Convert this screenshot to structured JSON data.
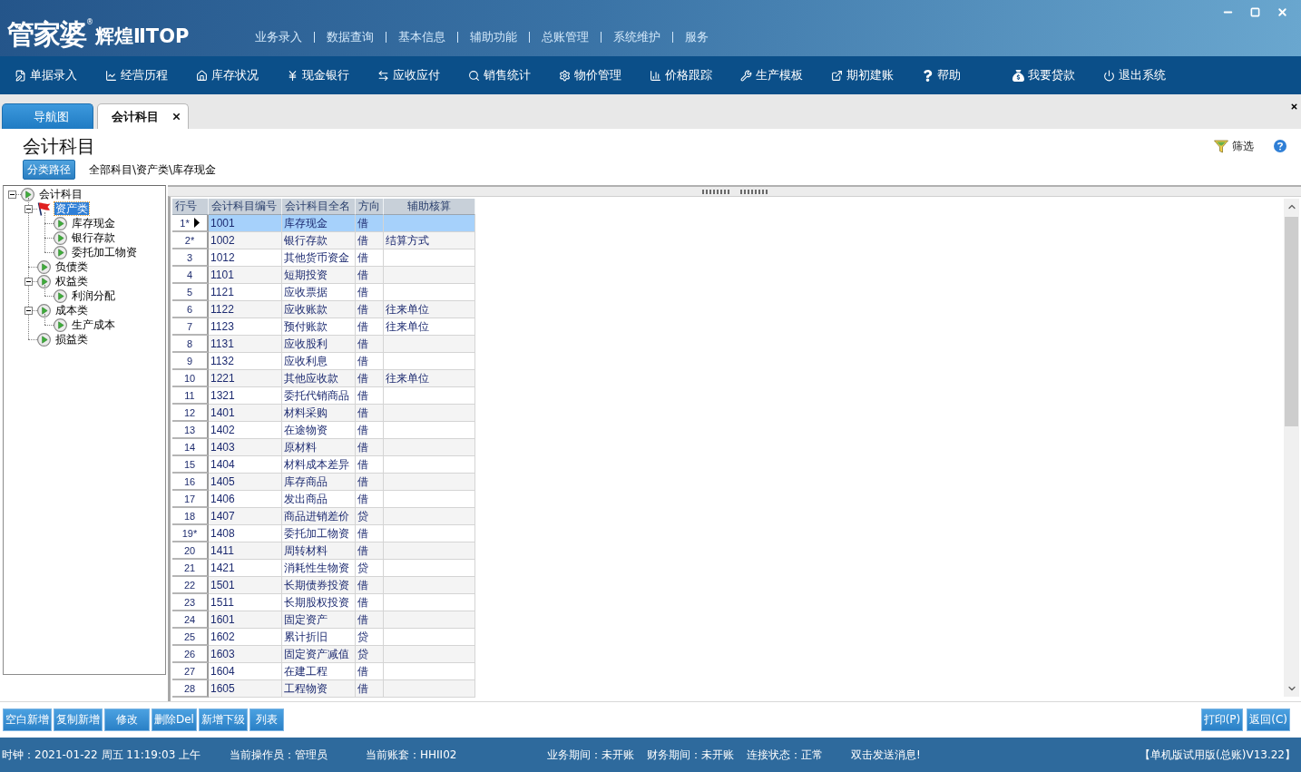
{
  "app_header": {
    "logo": {
      "main": "管家婆",
      "mark": "®",
      "sub": "辉煌ⅡTOP"
    },
    "menu": [
      "业务录入",
      "数据查询",
      "基本信息",
      "辅助功能",
      "总账管理",
      "系统维护",
      "服务"
    ]
  },
  "nav_toolbar": [
    "单据录入",
    "经营历程",
    "库存状况",
    "现金银行",
    "应收应付",
    "销售统计",
    "物价管理",
    "价格跟踪",
    "生产模板",
    "期初建账",
    "帮助",
    "我要贷款",
    "退出系统"
  ],
  "tabs": [
    {
      "label": "导航图",
      "selected": false,
      "closable": false
    },
    {
      "label": "会计科目",
      "selected": true,
      "closable": true
    }
  ],
  "page": {
    "title": "会计科目",
    "filter_label": "筛选",
    "path_button": "分类路径",
    "path": "全部科目\\资产类\\库存现金"
  },
  "tree": [
    {
      "label": "会计科目",
      "selected": false,
      "expanded": true,
      "children": [
        {
          "label": "资产类",
          "selected": true,
          "expanded": true,
          "children": [
            {
              "label": "库存现金",
              "selected": false
            },
            {
              "label": "银行存款",
              "selected": false
            },
            {
              "label": "委托加工物资",
              "selected": false
            }
          ]
        },
        {
          "label": "负债类",
          "selected": false
        },
        {
          "label": "权益类",
          "selected": false,
          "expanded": true,
          "children": [
            {
              "label": "利润分配",
              "selected": false
            }
          ]
        },
        {
          "label": "成本类",
          "selected": false,
          "expanded": true,
          "children": [
            {
              "label": "生产成本",
              "selected": false
            }
          ]
        },
        {
          "label": "损益类",
          "selected": false
        }
      ]
    }
  ],
  "table": {
    "columns": [
      "行号",
      "会计科目编号",
      "会计科目全名",
      "方向",
      "辅助核算"
    ],
    "rows": [
      {
        "no": "1*",
        "code": "1001",
        "name": "库存现金",
        "direction": "借",
        "selected": true
      },
      {
        "no": "2*",
        "code": "1002",
        "name": "银行存款",
        "direction": "借",
        "auxiliary": "结算方式",
        "selected": false
      },
      {
        "no": "3",
        "code": "1012",
        "name": "其他货币资金",
        "direction": "借",
        "selected": false
      },
      {
        "no": "4",
        "code": "1101",
        "name": "短期投资",
        "direction": "借",
        "selected": false
      },
      {
        "no": "5",
        "code": "1121",
        "name": "应收票据",
        "direction": "借",
        "selected": false
      },
      {
        "no": "6",
        "code": "1122",
        "name": "应收账款",
        "direction": "借",
        "auxiliary": "往来单位",
        "selected": false
      },
      {
        "no": "7",
        "code": "1123",
        "name": "预付账款",
        "direction": "借",
        "auxiliary": "往来单位",
        "selected": false
      },
      {
        "no": "8",
        "code": "1131",
        "name": "应收股利",
        "direction": "借",
        "selected": false
      },
      {
        "no": "9",
        "code": "1132",
        "name": "应收利息",
        "direction": "借",
        "selected": false
      },
      {
        "no": "10",
        "code": "1221",
        "name": "其他应收款",
        "direction": "借",
        "auxiliary": "往来单位",
        "selected": false
      },
      {
        "no": "11",
        "code": "1321",
        "name": "委托代销商品",
        "direction": "借",
        "selected": false
      },
      {
        "no": "12",
        "code": "1401",
        "name": "材料采购",
        "direction": "借",
        "selected": false
      },
      {
        "no": "13",
        "code": "1402",
        "name": "在途物资",
        "direction": "借",
        "selected": false
      },
      {
        "no": "14",
        "code": "1403",
        "name": "原材料",
        "direction": "借",
        "selected": false
      },
      {
        "no": "15",
        "code": "1404",
        "name": "材料成本差异",
        "direction": "借",
        "selected": false
      },
      {
        "no": "16",
        "code": "1405",
        "name": "库存商品",
        "direction": "借",
        "selected": false
      },
      {
        "no": "17",
        "code": "1406",
        "name": "发出商品",
        "direction": "借",
        "selected": false
      },
      {
        "no": "18",
        "code": "1407",
        "name": "商品进销差价",
        "direction": "贷",
        "selected": false
      },
      {
        "no": "19*",
        "code": "1408",
        "name": "委托加工物资",
        "direction": "借",
        "selected": false
      },
      {
        "no": "20",
        "code": "1411",
        "name": "周转材料",
        "direction": "借",
        "selected": false
      },
      {
        "no": "21",
        "code": "1421",
        "name": "消耗性生物资",
        "direction": "贷",
        "selected": false
      },
      {
        "no": "22",
        "code": "1501",
        "name": "长期债券投资",
        "direction": "借",
        "selected": false
      },
      {
        "no": "23",
        "code": "1511",
        "name": "长期股权投资",
        "direction": "借",
        "selected": false
      },
      {
        "no": "24",
        "code": "1601",
        "name": "固定资产",
        "direction": "借",
        "selected": false
      },
      {
        "no": "25",
        "code": "1602",
        "name": "累计折旧",
        "direction": "贷",
        "selected": false
      },
      {
        "no": "26",
        "code": "1603",
        "name": "固定资产减值",
        "direction": "贷",
        "selected": false
      },
      {
        "no": "27",
        "code": "1604",
        "name": "在建工程",
        "direction": "借",
        "selected": false
      },
      {
        "no": "28",
        "code": "1605",
        "name": "工程物资",
        "direction": "借",
        "selected": false
      }
    ]
  },
  "actions": {
    "left": [
      "空白新增",
      "复制新增",
      "修改",
      "删除Del",
      "新增下级",
      "列表"
    ],
    "right": [
      "打印(P)",
      "返回(C)"
    ]
  },
  "status_bar": [
    "时钟：2021-01-22 周五 11:19:03 上午",
    "当前操作员：管理员",
    "当前账套：HHII02",
    "业务期间：未开账",
    "财务期间：未开账",
    "连接状态：正常",
    "双击发送消息!",
    "【单机版试用版(总账)V13.22】"
  ]
}
